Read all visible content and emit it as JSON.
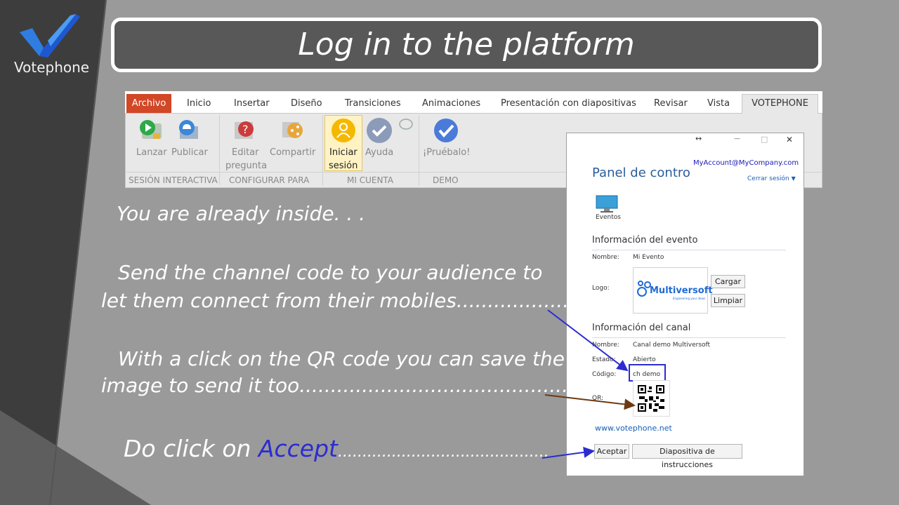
{
  "brand": {
    "name": "Votephone"
  },
  "title": "Log in to the platform",
  "ribbon": {
    "tabs": [
      "Archivo",
      "Inicio",
      "Insertar",
      "Diseño",
      "Transiciones",
      "Animaciones",
      "Presentación con diapositivas",
      "Revisar",
      "Vista",
      "VOTEPHONE"
    ],
    "buttons": {
      "lanzar": "Lanzar",
      "publicar": "Publicar",
      "editar_1": "Editar",
      "editar_2": "pregunta",
      "compartir": "Compartir",
      "iniciar_1": "Iniciar",
      "iniciar_2": "sesión",
      "ayuda": "Ayuda",
      "pruebalo": "¡Pruébalo!"
    },
    "groups": [
      "SESIÓN INTERACTIVA",
      "CONFIGURAR PARA",
      "MI CUENTA",
      "DEMO"
    ]
  },
  "instructions": {
    "inside": "You are already inside. . .",
    "send_1": "Send the channel code to your audience to",
    "send_2": "let them connect from their mobiles.......................",
    "qr_1": "With a click on the QR code you can save the",
    "qr_2": "image to send it too...........................................................",
    "accept_prefix": "Do click on ",
    "accept_word": "Accept",
    "accept_dots": "..........................................."
  },
  "dialog": {
    "resize_glyph": "↔",
    "minimize_glyph": "—",
    "maximize_glyph": "□",
    "close_glyph": "✕",
    "account": "MyAccount@MyCompany.com",
    "title": "Panel de control",
    "logout": "Cerrar sesión",
    "eventos": "Eventos",
    "event_section": "Información del evento",
    "nombre_label": "Nombre:",
    "event_name": "Mi Evento",
    "logo_label": "Logo:",
    "logo_text": "Multiversoft",
    "logo_sub": "Engineering your ideas",
    "cargar": "Cargar",
    "limpiar": "Limpiar",
    "channel_section": "Información del canal",
    "channel_name_label": "Nombre:",
    "channel_name": "Canal demo Multiversoft",
    "estado_label": "Estado:",
    "estado": "Abierto",
    "codigo_label": "Código:",
    "codigo": "ch demo",
    "qr_label": "QR:",
    "website": "www.votephone.net",
    "aceptar": "Aceptar",
    "diapositiva": "Diapositiva de instrucciones"
  },
  "colors": {
    "accent_blue": "#2c2cd0",
    "arrow_brown": "#6b3a14",
    "archivo_red": "#d24726",
    "link_blue": "#1a5fb4",
    "logo_blue": "#1f6ad6"
  }
}
